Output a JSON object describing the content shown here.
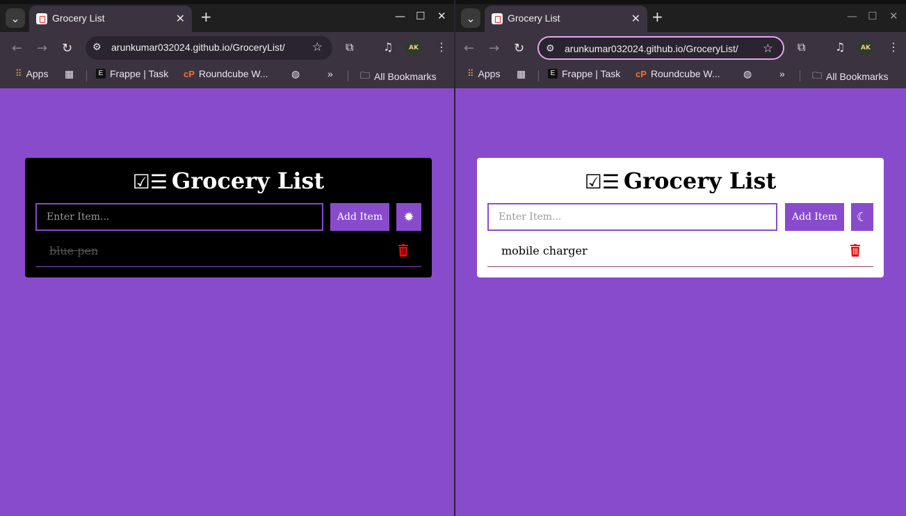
{
  "left": {
    "tab_title": "Grocery List",
    "url": "arunkumar032024.github.io/GroceryList/",
    "bookmarks": {
      "apps": "Apps",
      "frappe": "Frappe | Task",
      "roundcube": "Roundcube W...",
      "more": "»",
      "all": "All Bookmarks"
    },
    "app": {
      "title": "Grocery List",
      "input_placeholder": "Enter Item...",
      "add_label": "Add Item",
      "theme_icon": "sun-icon",
      "items": [
        {
          "text": "blue pen",
          "done": true
        }
      ]
    }
  },
  "right": {
    "tab_title": "Grocery List",
    "url": "arunkumar032024.github.io/GroceryList/",
    "bookmarks": {
      "apps": "Apps",
      "frappe": "Frappe | Task",
      "roundcube": "Roundcube W...",
      "more": "»",
      "all": "All Bookmarks"
    },
    "app": {
      "title": "Grocery List",
      "input_placeholder": "Enter Item...",
      "add_label": "Add Item",
      "theme_icon": "moon-icon",
      "items": [
        {
          "text": "mobile charger",
          "done": false
        }
      ]
    }
  },
  "avatar_initials": "AK",
  "colors": {
    "accent": "#884bcc",
    "trash": "#e01010",
    "dark_card": "#000000",
    "light_card": "#ffffff"
  }
}
